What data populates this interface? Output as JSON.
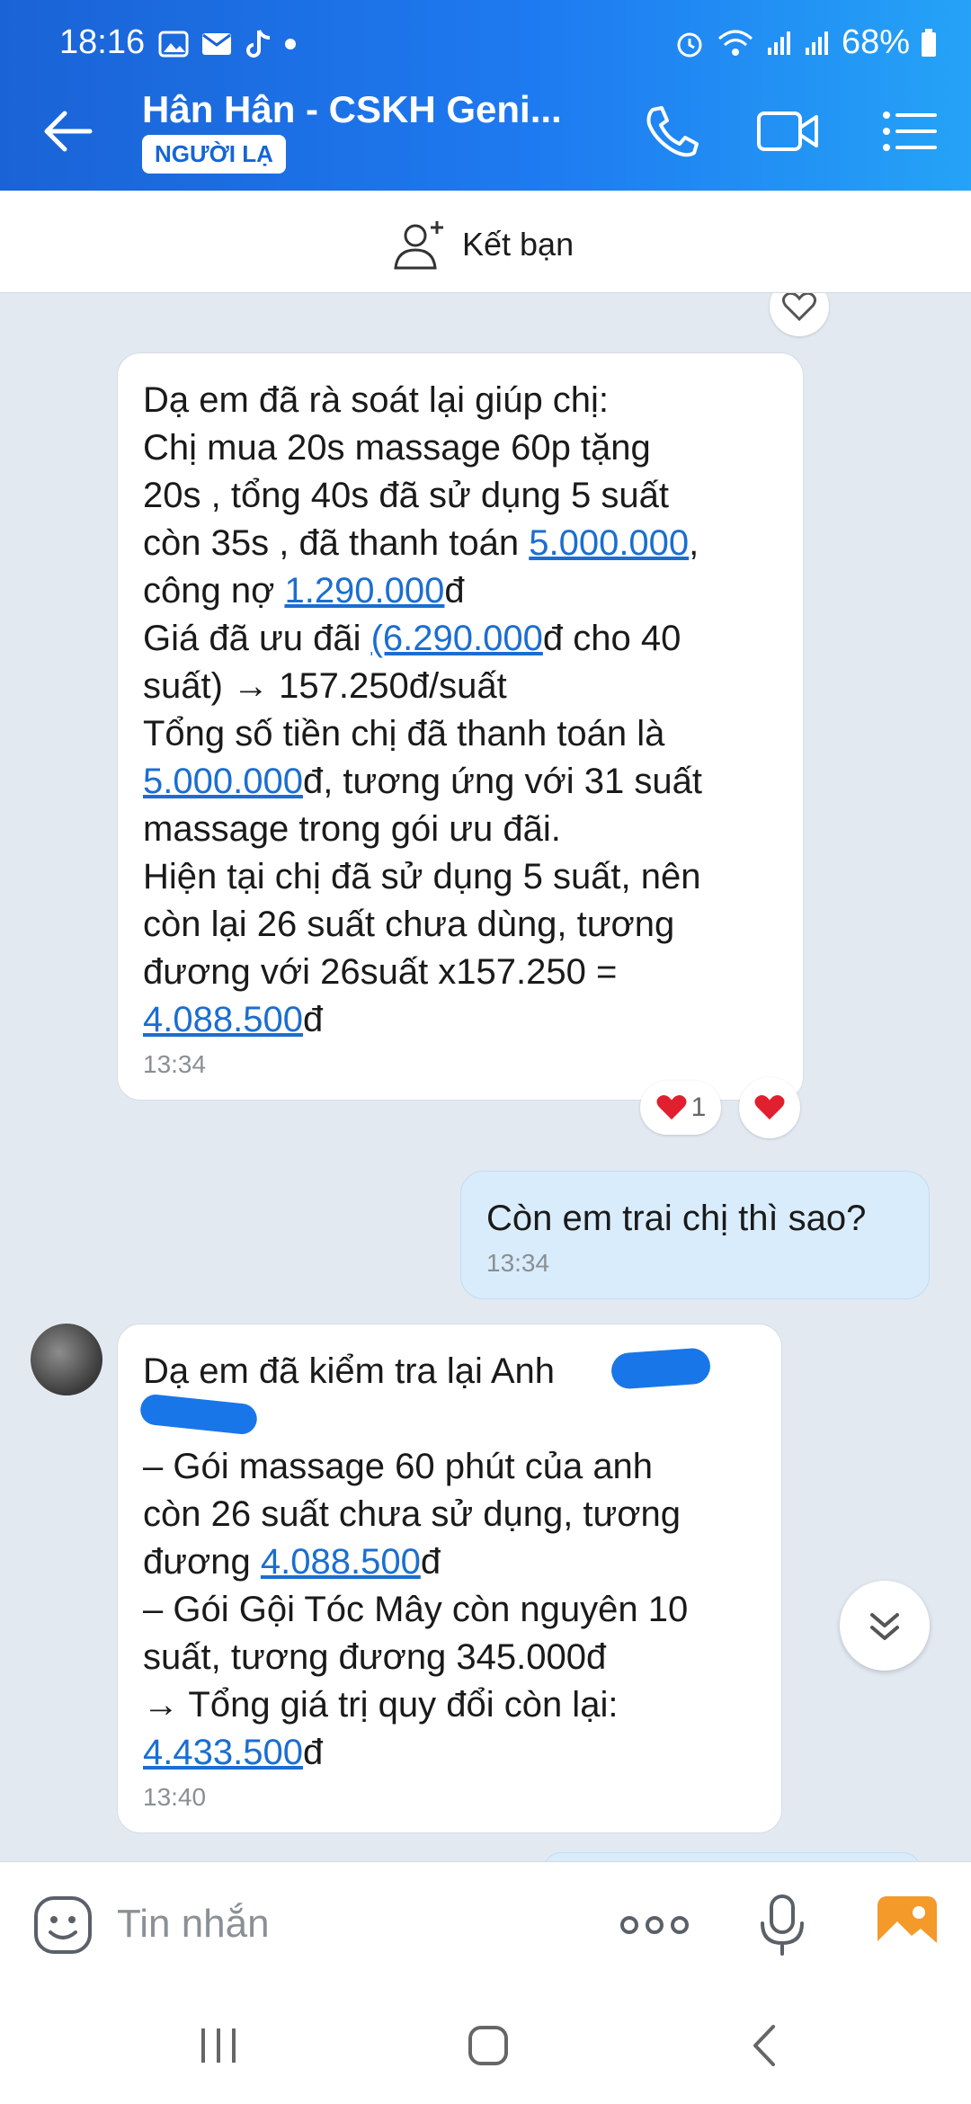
{
  "status_bar": {
    "time": "18:16",
    "battery": "68%"
  },
  "header": {
    "title": "Hân Hân - CSKH Geni...",
    "badge": "NGƯỜI LẠ"
  },
  "add_friend": {
    "label": "Kết bạn"
  },
  "messages": [
    {
      "id": "m1",
      "direction": "incoming",
      "segments": [
        {
          "t": "Dạ em đã rà soát lại giúp chị:\nChị mua 20s massage 60p tặng\n20s , tổng 40s đã sử dụng 5 suất\ncòn 35s , đã thanh toán "
        },
        {
          "t": "5.000.000",
          "link": true
        },
        {
          "t": ",\ncông nợ "
        },
        {
          "t": "1.290.000",
          "link": true
        },
        {
          "t": "đ\nGiá đã ưu đãi "
        },
        {
          "t": "(6.290.000",
          "link": true
        },
        {
          "t": "đ cho 40\nsuất) → 157.250đ/suất\nTổng số tiền chị đã thanh toán là\n"
        },
        {
          "t": "5.000.000",
          "link": true
        },
        {
          "t": "đ, tương ứng với 31 suất\nmassage trong gói ưu đãi.\nHiện tại chị đã sử dụng 5 suất, nên\ncòn lại 26 suất chưa dùng, tương\nđương với 26suất x157.250 =\n"
        },
        {
          "t": "4.088.500",
          "link": true
        },
        {
          "t": "đ"
        }
      ],
      "time": "13:34",
      "reaction_count": "1"
    },
    {
      "id": "m2",
      "direction": "outgoing",
      "segments": [
        {
          "t": "Còn em trai chị thì sao?"
        }
      ],
      "time": "13:34"
    },
    {
      "id": "m3",
      "direction": "incoming",
      "segments": [
        {
          "t": "Dạ em đã kiểm tra lại Anh \n\n– Gói massage 60 phút của anh\ncòn 26 suất chưa sử dụng, tương\nđương "
        },
        {
          "t": "4.088.500",
          "link": true
        },
        {
          "t": "đ\n– Gói Gội Tóc Mây còn nguyên 10\nsuất, tương đương 345.000đ\n→ Tổng giá trị quy đổi còn lại:\n"
        },
        {
          "t": "4.433.500",
          "link": true
        },
        {
          "t": "đ"
        }
      ],
      "time": "13:40"
    }
  ],
  "composer": {
    "placeholder": "Tin nhắn"
  },
  "colors": {
    "accent": "#1e7af0",
    "link": "#1b6ed1",
    "outgoing_bubble": "#d9ecfb",
    "chat_bg": "#e2e9f1"
  }
}
